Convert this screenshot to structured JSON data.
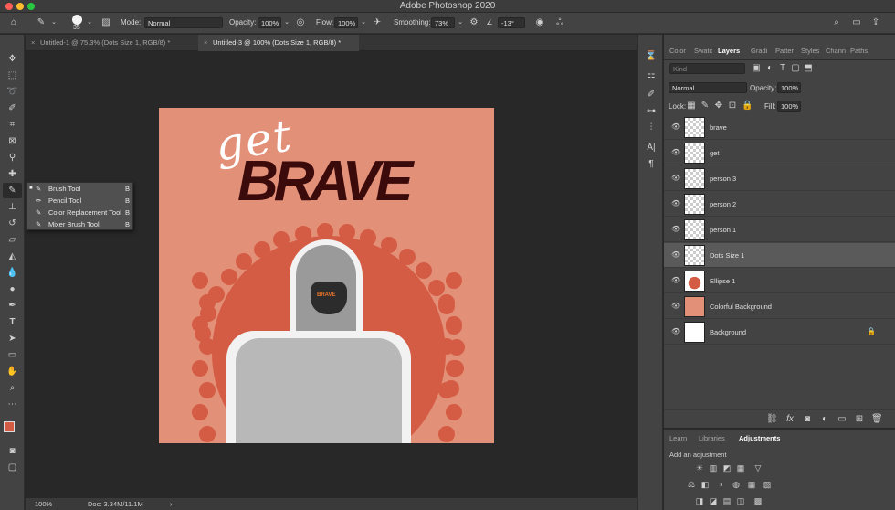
{
  "window": {
    "title": "Adobe Photoshop 2020"
  },
  "options_bar": {
    "brush_size": "35",
    "mode_label": "Mode:",
    "mode_value": "Normal",
    "opacity_label": "Opacity:",
    "opacity_value": "100%",
    "flow_label": "Flow:",
    "flow_value": "100%",
    "smoothing_label": "Smoothing:",
    "smoothing_value": "73%",
    "angle_value": "-13°"
  },
  "document_tabs": [
    {
      "label": "Untitled-1 @ 75.3% (Dots Size 1, RGB/8) *",
      "active": false
    },
    {
      "label": "Untitled-3 @ 100% (Dots Size 1, RGB/8) *",
      "active": true
    }
  ],
  "artwork": {
    "script_text": "get",
    "title_text": "BRAVE",
    "mask_text": "BRAVE",
    "background_color": "#e39079",
    "accent_color": "#d55c44",
    "title_color": "#3b0a0a"
  },
  "status_bar": {
    "zoom": "100%",
    "doc": "Doc: 3.34M/11.1M"
  },
  "tool_flyout": [
    {
      "label": "Brush Tool",
      "key": "B",
      "active": true,
      "icon": "brush-icon"
    },
    {
      "label": "Pencil Tool",
      "key": "B",
      "active": false,
      "icon": "pencil-icon"
    },
    {
      "label": "Color Replacement Tool",
      "key": "B",
      "active": false,
      "icon": "color-replacement-icon"
    },
    {
      "label": "Mixer Brush Tool",
      "key": "B",
      "active": false,
      "icon": "mixer-brush-icon"
    }
  ],
  "layers_panel": {
    "tabs": [
      "Color",
      "Swatc",
      "Layers",
      "Gradi",
      "Patter",
      "Styles",
      "Chann",
      "Paths"
    ],
    "active_tab": "Layers",
    "kind_placeholder": "Kind",
    "blend_mode": "Normal",
    "opacity_label": "Opacity:",
    "opacity_value": "100%",
    "lock_label": "Lock:",
    "fill_label": "Fill:",
    "fill_value": "100%",
    "layers": [
      {
        "name": "brave",
        "thumb": "text"
      },
      {
        "name": "get",
        "thumb": "blank"
      },
      {
        "name": "person 3",
        "thumb": "person"
      },
      {
        "name": "person 2",
        "thumb": "person"
      },
      {
        "name": "person 1",
        "thumb": "person"
      },
      {
        "name": "Dots Size 1",
        "thumb": "dots",
        "selected": true
      },
      {
        "name": "Ellipse 1",
        "thumb": "ellipse"
      },
      {
        "name": "Colorful Background",
        "thumb": "color"
      },
      {
        "name": "Background",
        "thumb": "white",
        "locked": true
      }
    ]
  },
  "bottom_panel": {
    "tabs": [
      "Learn",
      "Libraries",
      "Adjustments"
    ],
    "active_tab": "Adjustments",
    "hint": "Add an adjustment"
  }
}
